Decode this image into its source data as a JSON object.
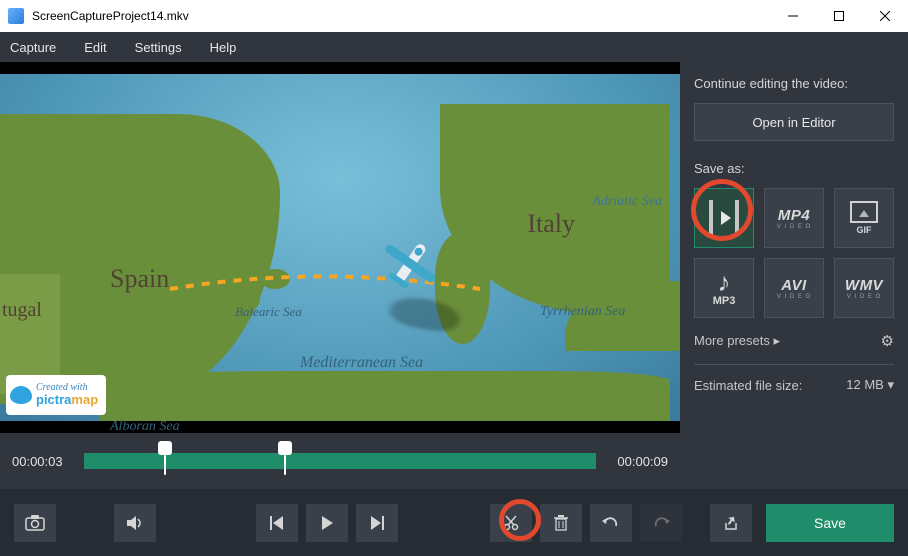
{
  "window": {
    "title": "ScreenCaptureProject14.mkv"
  },
  "menu": {
    "items": [
      "Capture",
      "Edit",
      "Settings",
      "Help"
    ]
  },
  "map": {
    "labels": {
      "spain": "Spain",
      "italy": "Italy",
      "portugal": "tugal",
      "mediterranean": "Mediterranean Sea",
      "balearic": "Balearic Sea",
      "tyrrhenian": "Tyrrhenian\nSea",
      "adriatic": "Adriatic Sea",
      "alboran": "Alboran\nSea"
    },
    "watermark": {
      "created": "Created with",
      "brand1": "pictra",
      "brand2": "map"
    }
  },
  "timeline": {
    "current": "00:00:03",
    "duration": "00:00:09"
  },
  "panel": {
    "continue_label": "Continue editing the video:",
    "open_editor": "Open in Editor",
    "save_as": "Save as:",
    "formats": {
      "mp4": "MP4",
      "gif": "GIF",
      "mp3": "MP3",
      "avi": "AVI",
      "wmv": "WMV",
      "video_sub": "V I D E O"
    },
    "more_presets": "More presets",
    "est_label": "Estimated file size:",
    "est_value": "12 MB"
  },
  "toolbar": {
    "save": "Save"
  }
}
